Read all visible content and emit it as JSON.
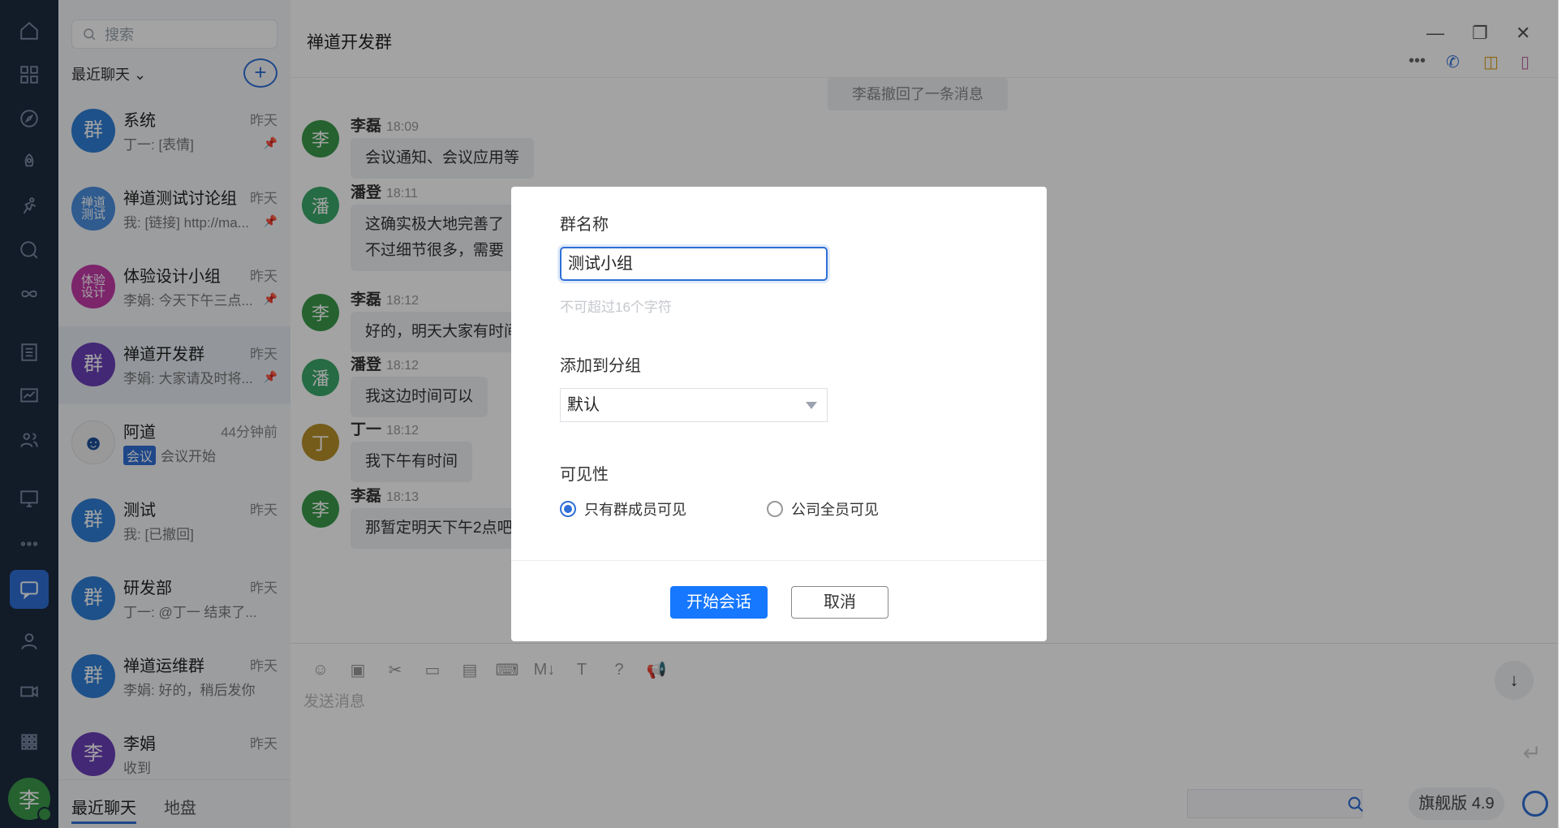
{
  "colors": {
    "accent": "#2f6fd6",
    "sidebar": "#1d2b3f",
    "primary_button": "#1677ff"
  },
  "search": {
    "placeholder": "搜索"
  },
  "list_header": {
    "recent_label": "最近聊天"
  },
  "chats": [
    {
      "name": "系统",
      "time": "昨天",
      "preview": "丁一: [表情]",
      "avatar": "群",
      "avatar_color": "#2f7fd6",
      "pinned": true
    },
    {
      "name": "禅道测试讨论组",
      "time": "昨天",
      "preview": "我: [链接] http://ma...",
      "avatar": "禅道测试",
      "avatar_color": "#4a8fe0",
      "pinned": true
    },
    {
      "name": "体验设计小组",
      "time": "昨天",
      "preview": "李娟: 今天下午三点...",
      "avatar": "体验设计",
      "avatar_color": "#c23aa8",
      "pinned": true
    },
    {
      "name": "禅道开发群",
      "time": "昨天",
      "preview": "李娟: 大家请及时将...",
      "avatar": "群",
      "avatar_color": "#6a3fb8",
      "pinned": true
    },
    {
      "name": "阿道",
      "time": "44分钟前",
      "preview": "会议开始",
      "tag": "会议",
      "avatar": "",
      "avatar_color": "#f0f0f0",
      "pinned": false
    },
    {
      "name": "测试",
      "time": "昨天",
      "preview": "我: [已撤回]",
      "avatar": "群",
      "avatar_color": "#2f7fd6",
      "pinned": false
    },
    {
      "name": "研发部",
      "time": "昨天",
      "preview": "丁一: @丁一 结束了...",
      "avatar": "群",
      "avatar_color": "#2f7fd6",
      "pinned": false
    },
    {
      "name": "禅道运维群",
      "time": "昨天",
      "preview": "李娟: 好的，稍后发你",
      "avatar": "群",
      "avatar_color": "#2f7fd6",
      "pinned": false
    },
    {
      "name": "李娟",
      "time": "昨天",
      "preview": "收到",
      "avatar": "李",
      "avatar_color": "#6a3fb8",
      "pinned": false
    }
  ],
  "bottom_tabs": {
    "recent": "最近聊天",
    "disk": "地盘"
  },
  "self_avatar": "李",
  "chat": {
    "title": "禅道开发群",
    "system_notice": "李磊撤回了一条消息",
    "messages": [
      {
        "sender": "李磊",
        "time": "18:09",
        "text": "会议通知、会议应用等",
        "avatar": "李",
        "avatar_color": "#3a9a4a"
      },
      {
        "sender": "潘登",
        "time": "18:11",
        "text": "这确实极大地完善了",
        "avatar": "潘",
        "avatar_color": "#3aa86a"
      },
      {
        "sender": "",
        "time": "",
        "text": "不过细节很多，需要",
        "avatar": "",
        "avatar_color": ""
      },
      {
        "sender": "李磊",
        "time": "18:12",
        "text": "好的，明天大家有时间",
        "avatar": "李",
        "avatar_color": "#3a9a4a"
      },
      {
        "sender": "潘登",
        "time": "18:12",
        "text": "我这边时间可以",
        "avatar": "潘",
        "avatar_color": "#3aa86a"
      },
      {
        "sender": "丁一",
        "time": "18:12",
        "text": "我下午有时间",
        "avatar": "丁",
        "avatar_color": "#b8902a"
      },
      {
        "sender": "李磊",
        "time": "18:13",
        "text": "那暂定明天下午2点吧",
        "avatar": "李",
        "avatar_color": "#3a9a4a"
      }
    ],
    "input_placeholder": "发送消息"
  },
  "version_badge": "旗舰版 4.9",
  "dialog": {
    "name_label": "群名称",
    "name_value": "测试小组",
    "name_hint": "不可超过16个字符",
    "group_label": "添加到分组",
    "group_value": "默认",
    "visibility_label": "可见性",
    "visibility_options": [
      {
        "label": "只有群成员可见",
        "selected": true
      },
      {
        "label": "公司全员可见",
        "selected": false
      }
    ],
    "confirm_label": "开始会话",
    "cancel_label": "取消"
  }
}
